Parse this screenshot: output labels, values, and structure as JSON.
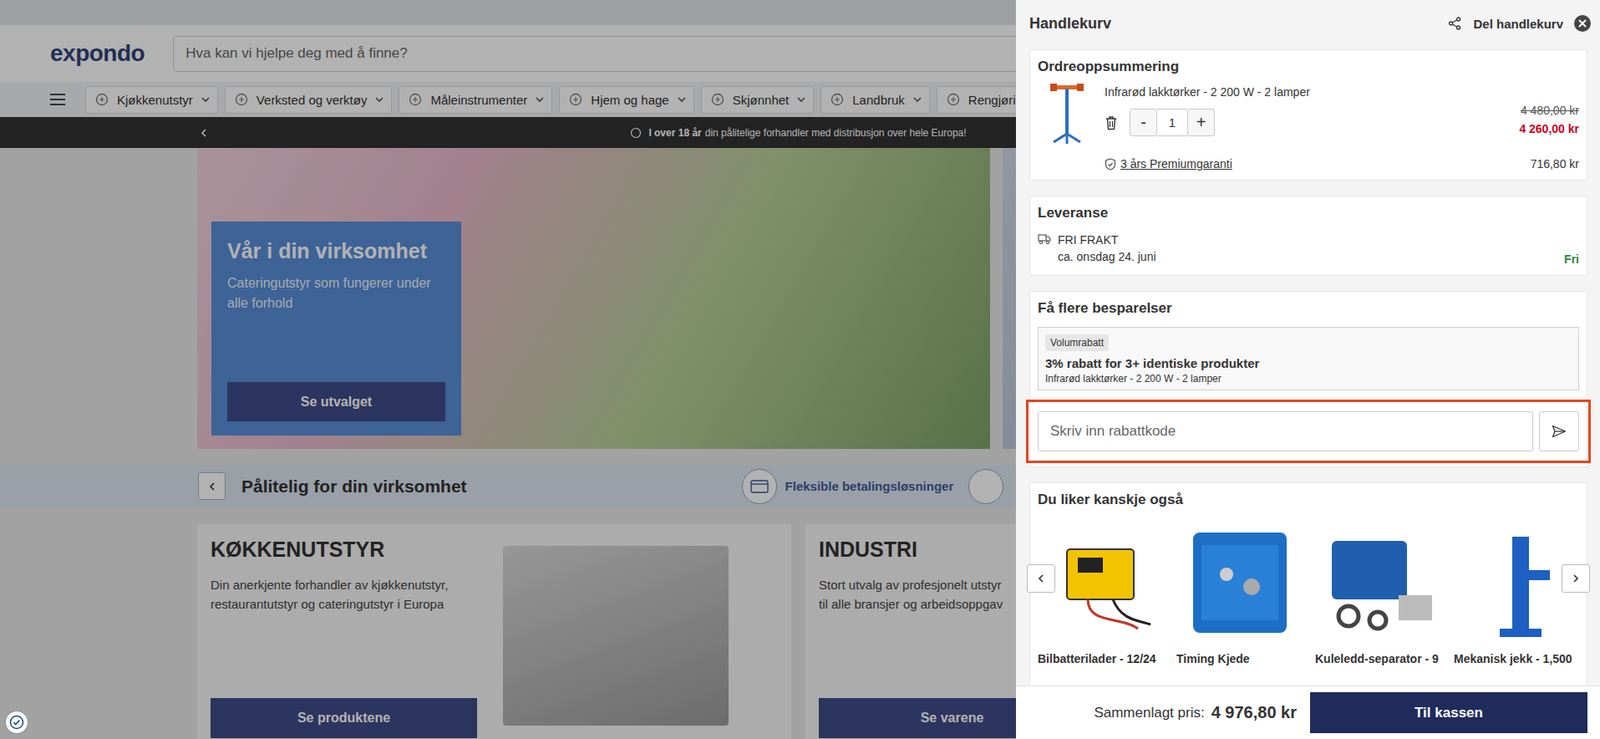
{
  "header": {
    "logo": "expondo",
    "search": {
      "placeholder": "Hva kan vi hjelpe deg med å finne?"
    }
  },
  "nav": [
    {
      "label": "Kjøkkenutstyr"
    },
    {
      "label": "Verksted og verktøy"
    },
    {
      "label": "Måleinstrumenter"
    },
    {
      "label": "Hjem og hage"
    },
    {
      "label": "Skjønnhet"
    },
    {
      "label": "Landbruk"
    },
    {
      "label": "Rengjøring"
    }
  ],
  "announcement": {
    "bold": "I over 18 år",
    "text": "din pålitelige forhandler med distribusjon over hele Europa!"
  },
  "hero": {
    "title": "Vår i din virksomhet",
    "subtitle": "Cateringutstyr som fungerer under alle forhold",
    "button": "Se utvalget"
  },
  "trust": {
    "title": "Pålitelig for din virksomhet",
    "items": [
      {
        "label": "Fleksible betalingsløsninger"
      }
    ]
  },
  "categories": [
    {
      "title": "KØKKENUTSTYR",
      "lines": [
        "Din anerkjente forhandler av kjøkkenutstyr,",
        "restaurantutstyr og cateringutstyr i Europa"
      ],
      "button": "Se produktene"
    },
    {
      "title": "INDUSTRI",
      "lines": [
        "Stort utvalg av profesjonelt utstyr",
        "til alle bransjer og arbeidsoppgav"
      ],
      "button": "Se varene"
    }
  ],
  "cart": {
    "title": "Handlekurv",
    "share": "Del handlekurv",
    "summary": {
      "title": "Ordreoppsummering",
      "items": [
        {
          "name": "Infrarød lakktørker - 2 200 W - 2 lamper",
          "decrease": "-",
          "quantity": "1",
          "increase": "+",
          "old_price": "4 480,00 kr",
          "price": "4 260,00 kr",
          "warranty": "3 års Premiumgaranti",
          "warranty_price": "716,80 kr"
        }
      ]
    },
    "delivery": {
      "title": "Leveranse",
      "method": "FRI FRAKT",
      "eta": "ca. onsdag 24. juni",
      "cost": "Fri"
    },
    "savings": {
      "title": "Få flere besparelser",
      "offers": [
        {
          "tag": "Volumrabatt",
          "title": "3% rabatt for 3+ identiske produkter",
          "product": "Infrarød lakktørker - 2 200 W - 2 lamper"
        }
      ],
      "coupon": {
        "placeholder": "Skriv inn rabattkode",
        "highlighted": true
      }
    },
    "recommendations": {
      "title": "Du liker kanskje også",
      "products": [
        {
          "name": "Bilbatterilader - 12/24"
        },
        {
          "name": "Timing Kjede"
        },
        {
          "name": "Kuleledd-separator - 9"
        },
        {
          "name": "Mekanisk jekk - 1,500"
        }
      ]
    },
    "total": {
      "label": "Sammenlagt pris:",
      "value": "4 976,80 kr"
    },
    "checkout": "Til kassen"
  }
}
